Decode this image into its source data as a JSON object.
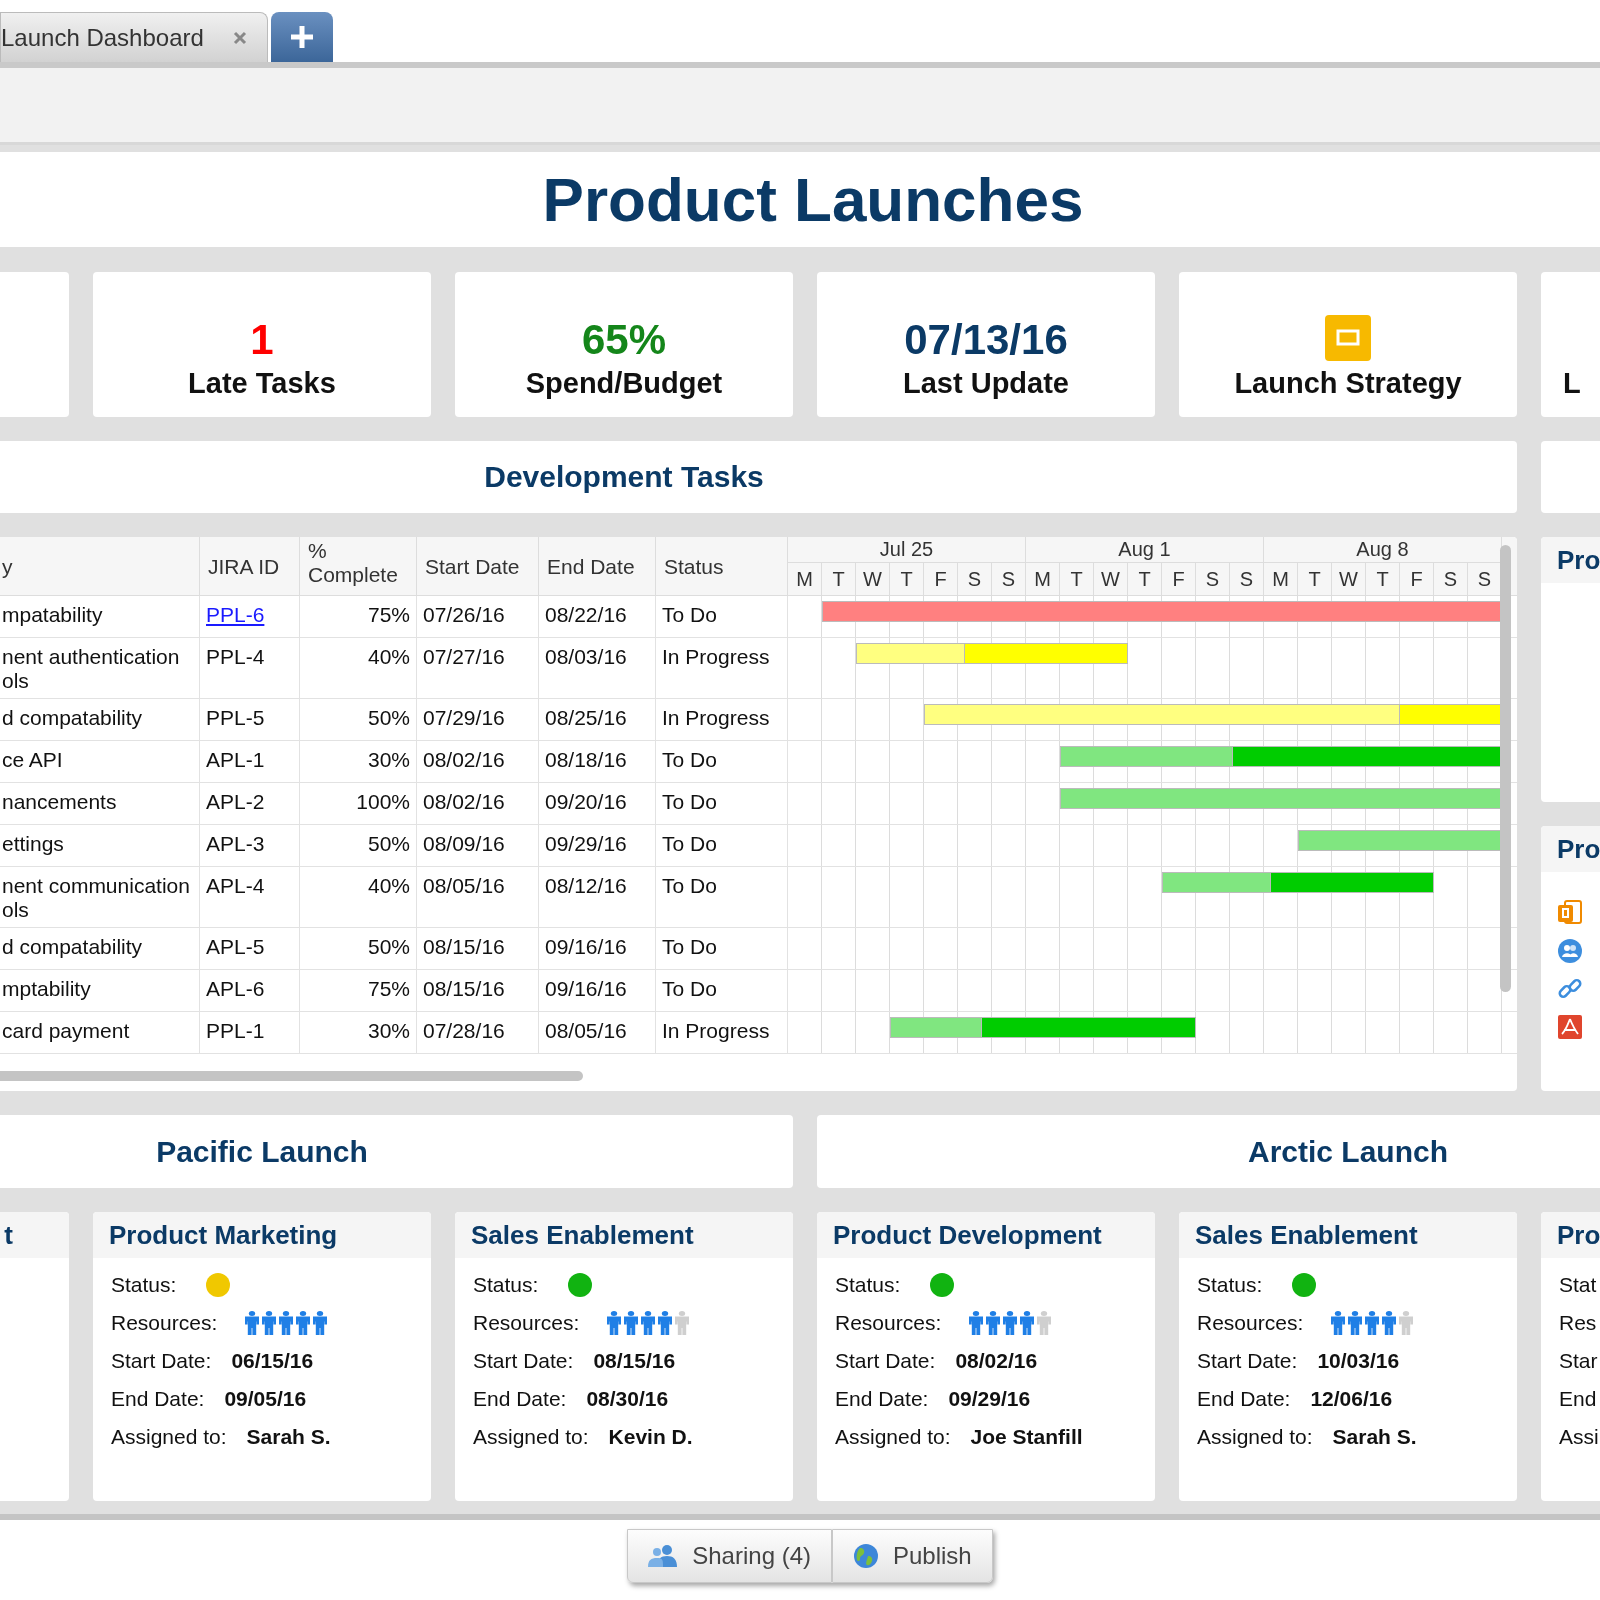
{
  "tab": {
    "label": "Launch Dashboard"
  },
  "title": "Product Launches",
  "kpis": [
    {
      "kind": "value",
      "value": "1",
      "label": "Late Tasks",
      "color": "#ff0000"
    },
    {
      "kind": "value",
      "value": "65%",
      "label": "Spend/Budget",
      "color": "#14861a"
    },
    {
      "kind": "value",
      "value": "07/13/16",
      "label": "Last Update",
      "color": "#0b3a66"
    },
    {
      "kind": "icon",
      "label": "Launch Strategy"
    },
    {
      "kind": "partial",
      "label": "L"
    }
  ],
  "development_tasks": {
    "title": "Development Tasks",
    "columns": [
      "y",
      "JIRA ID",
      "% Complete",
      "Start Date",
      "End Date",
      "Status"
    ],
    "timeline": {
      "weeks": [
        "Jul 25",
        "Aug 1",
        "Aug 8"
      ],
      "days": [
        "M",
        "T",
        "W",
        "T",
        "F",
        "S",
        "S",
        "M",
        "T",
        "W",
        "T",
        "F",
        "S",
        "S",
        "M",
        "T",
        "W",
        "T",
        "F",
        "S",
        "S"
      ]
    },
    "rows": [
      {
        "summary": "mpatability",
        "jira": "PPL-6",
        "link": true,
        "complete": "75%",
        "start": "07/26/16",
        "end": "08/22/16",
        "status": "To Do",
        "segments": [
          {
            "color": "#ff8080"
          }
        ]
      },
      {
        "summary": "nent authentication ols",
        "jira": "PPL-4",
        "link": false,
        "complete": "40%",
        "start": "07/27/16",
        "end": "08/03/16",
        "status": "In Progress",
        "segments": [
          {
            "color": "#ffff80"
          },
          {
            "color": "#ffff00"
          }
        ]
      },
      {
        "summary": "d compatability",
        "jira": "PPL-5",
        "link": false,
        "complete": "50%",
        "start": "07/29/16",
        "end": "08/25/16",
        "status": "In Progress",
        "segments": [
          {
            "color": "#ffff80"
          },
          {
            "color": "#ffff00"
          }
        ]
      },
      {
        "summary": "ce API",
        "jira": "APL-1",
        "link": false,
        "complete": "30%",
        "start": "08/02/16",
        "end": "08/18/16",
        "status": "To Do",
        "segments": [
          {
            "color": "#80e680"
          },
          {
            "color": "#00cc00"
          }
        ]
      },
      {
        "summary": "nancements",
        "jira": "APL-2",
        "link": false,
        "complete": "100%",
        "start": "08/02/16",
        "end": "09/20/16",
        "status": "To Do",
        "segments": [
          {
            "color": "#80e680"
          }
        ]
      },
      {
        "summary": "ettings",
        "jira": "APL-3",
        "link": false,
        "complete": "50%",
        "start": "08/09/16",
        "end": "09/29/16",
        "status": "To Do",
        "segments": [
          {
            "color": "#80e680"
          }
        ]
      },
      {
        "summary": "nent communication ols",
        "jira": "APL-4",
        "link": false,
        "complete": "40%",
        "start": "08/05/16",
        "end": "08/12/16",
        "status": "To Do",
        "segments": [
          {
            "color": "#80e680"
          },
          {
            "color": "#00cc00"
          }
        ]
      },
      {
        "summary": "d compatability",
        "jira": "APL-5",
        "link": false,
        "complete": "50%",
        "start": "08/15/16",
        "end": "09/16/16",
        "status": "To Do"
      },
      {
        "summary": "mptability",
        "jira": "APL-6",
        "link": false,
        "complete": "75%",
        "start": "08/15/16",
        "end": "09/16/16",
        "status": "To Do"
      },
      {
        "summary": "card payment",
        "jira": "PPL-1",
        "link": false,
        "complete": "30%",
        "start": "07/28/16",
        "end": "08/05/16",
        "status": "In Progress",
        "segments": [
          {
            "color": "#80e680"
          },
          {
            "color": "#00cc00"
          }
        ]
      }
    ]
  },
  "side_panels": [
    {
      "title": "Pro"
    },
    {
      "title": "Pro",
      "links": [
        {
          "kind": "slides"
        },
        {
          "kind": "people"
        },
        {
          "kind": "link"
        },
        {
          "kind": "pdf"
        }
      ]
    }
  ],
  "launches": [
    {
      "title": "Pacific Launch",
      "cards": [
        {
          "title": "t"
        },
        {
          "title": "Product Marketing",
          "fields": [
            {
              "kind": "status",
              "label": "Status:",
              "color": "#f0c800"
            },
            {
              "kind": "resources",
              "label": "Resources:",
              "stars": 5
            },
            {
              "kind": "text",
              "label": "Start Date:",
              "value": "06/15/16"
            },
            {
              "kind": "text",
              "label": "End Date:",
              "value": "09/05/16"
            },
            {
              "kind": "text",
              "label": "Assigned to:",
              "value": "Sarah S."
            }
          ]
        },
        {
          "title": "Sales Enablement",
          "fields": [
            {
              "kind": "status",
              "label": "Status:",
              "color": "#11b311"
            },
            {
              "kind": "resources",
              "label": "Resources:",
              "stars": 4
            },
            {
              "kind": "text",
              "label": "Start Date:",
              "value": "08/15/16"
            },
            {
              "kind": "text",
              "label": "End Date:",
              "value": "08/30/16"
            },
            {
              "kind": "text",
              "label": "Assigned to:",
              "value": "Kevin D."
            }
          ]
        }
      ]
    },
    {
      "title": "Arctic Launch",
      "cards": [
        {
          "title": "Product Development",
          "fields": [
            {
              "kind": "status",
              "label": "Status:",
              "color": "#11b311"
            },
            {
              "kind": "resources",
              "label": "Resources:",
              "stars": 4
            },
            {
              "kind": "text",
              "label": "Start Date:",
              "value": "08/02/16"
            },
            {
              "kind": "text",
              "label": "End Date:",
              "value": "09/29/16"
            },
            {
              "kind": "text",
              "label": "Assigned to:",
              "value": "Joe Stanfill"
            }
          ]
        },
        {
          "title": "Sales Enablement",
          "fields": [
            {
              "kind": "status",
              "label": "Status:",
              "color": "#11b311"
            },
            {
              "kind": "resources",
              "label": "Resources:",
              "stars": 4
            },
            {
              "kind": "text",
              "label": "Start Date:",
              "value": "10/03/16"
            },
            {
              "kind": "text",
              "label": "End Date:",
              "value": "12/06/16"
            },
            {
              "kind": "text",
              "label": "Assigned to:",
              "value": "Sarah S."
            }
          ]
        },
        {
          "title": "Pro",
          "fields": [
            {
              "kind": "text",
              "label": "Stat"
            },
            {
              "kind": "text",
              "label": "Res"
            },
            {
              "kind": "text",
              "label": "Star"
            },
            {
              "kind": "text",
              "label": "End"
            },
            {
              "kind": "text",
              "label": "Assi"
            }
          ]
        }
      ]
    }
  ],
  "footer_buttons": [
    {
      "kind": "sharing",
      "label": "Sharing (4)"
    },
    {
      "kind": "publish",
      "label": "Publish"
    }
  ]
}
